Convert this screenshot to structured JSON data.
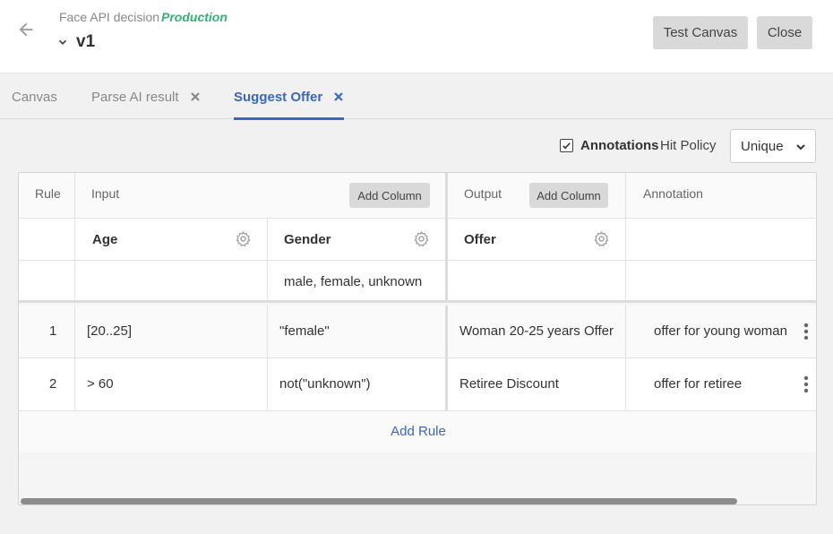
{
  "header": {
    "app_name": "Face API decision",
    "environment": "Production",
    "version": "v1",
    "test_button": "Test Canvas",
    "close_button": "Close"
  },
  "tabs": [
    {
      "label": "Canvas",
      "active": false,
      "closable": false
    },
    {
      "label": "Parse AI result",
      "active": false,
      "closable": true
    },
    {
      "label": "Suggest Offer",
      "active": true,
      "closable": true
    }
  ],
  "toolbar": {
    "annotations_label": "Annotations",
    "annotations_checked": true,
    "hit_policy_label": "Hit Policy",
    "hit_policy_value": "Unique"
  },
  "table": {
    "headers": {
      "rule": "Rule",
      "input": "Input",
      "input_add_column": "Add Column",
      "output": "Output",
      "output_add_column": "Add Column",
      "annotation": "Annotation"
    },
    "columns": {
      "age": "Age",
      "gender": "Gender",
      "offer": "Offer"
    },
    "allowed_values": {
      "age": "",
      "gender": "male, female, unknown",
      "offer": "",
      "annotation": ""
    },
    "rules": [
      {
        "number": "1",
        "age": "[20..25]",
        "gender": "\"female\"",
        "offer": "Woman 20-25 years Offer",
        "annotation": "offer for young woman"
      },
      {
        "number": "2",
        "age": "> 60",
        "gender": "not(\"unknown\")",
        "offer": "Retiree Discount",
        "annotation": "offer for retiree"
      }
    ],
    "add_rule": "Add Rule"
  },
  "colors": {
    "accent": "#3a66c4",
    "production": "#2bb673"
  }
}
